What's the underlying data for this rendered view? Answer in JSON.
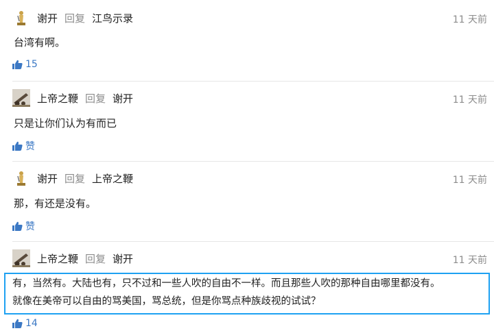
{
  "reply_word": "回复",
  "comments": [
    {
      "author": "谢开",
      "reply_to": "江鸟示录",
      "time": "11 天前",
      "text": "台湾有啊。",
      "likes": "15",
      "avatar": "figurine-avatar"
    },
    {
      "author": "上帝之鞭",
      "reply_to": "谢开",
      "time": "11 天前",
      "text": "只是让你们认为有而已",
      "likes": "赞",
      "avatar": "cannon-avatar"
    },
    {
      "author": "谢开",
      "reply_to": "上帝之鞭",
      "time": "11 天前",
      "text": "那，有还是没有。",
      "likes": "赞",
      "avatar": "figurine-avatar"
    },
    {
      "author": "上帝之鞭",
      "reply_to": "谢开",
      "time": "11 天前",
      "text_lines": [
        "有，当然有。大陆也有，只不过和一些人吹的自由不一样。而且那些人吹的那种自由哪里都没有。",
        "就像在美帝可以自由的骂美国，骂总统，但是你骂点种族歧视的试试？"
      ],
      "likes": "14",
      "avatar": "cannon-avatar"
    }
  ],
  "colors": {
    "accent": "#3b78c4",
    "muted": "#8c8c8c",
    "highlight_border": "#1da1f2"
  }
}
